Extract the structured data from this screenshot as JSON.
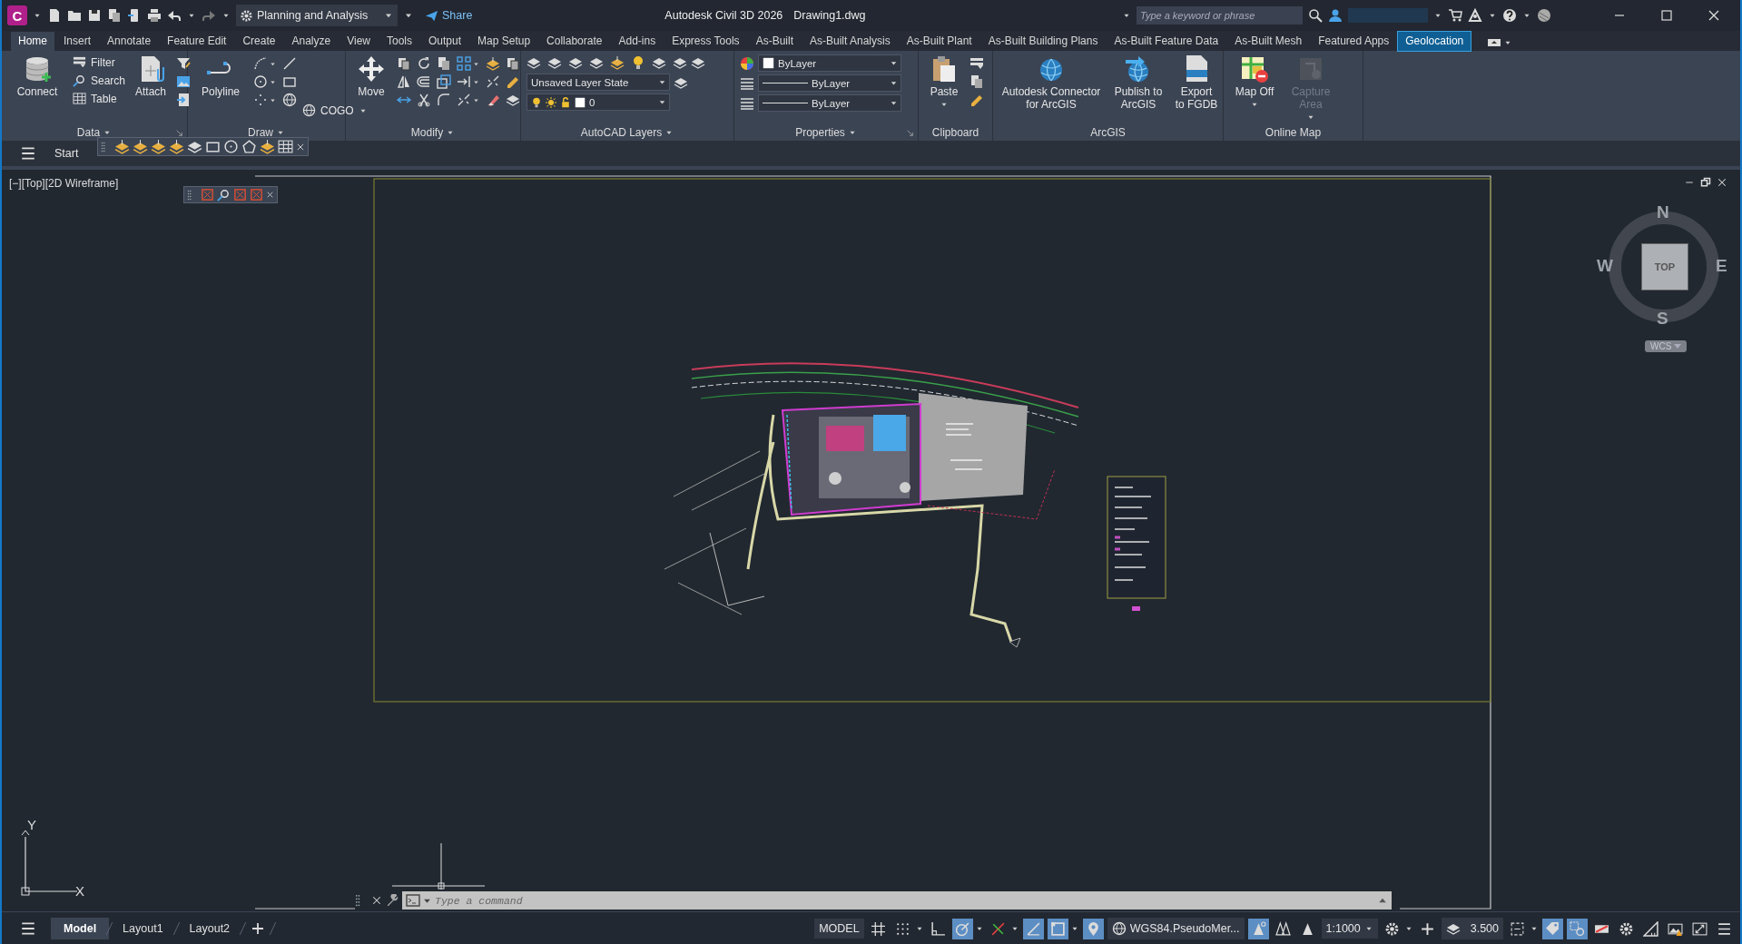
{
  "title_bar": {
    "app_letter": "C",
    "workspace": "Planning and Analysis",
    "share": "Share",
    "app_title": "Autodesk Civil 3D 2026",
    "file_name": "Drawing1.dwg",
    "search": {
      "placeholder": "Type a keyword or phrase"
    }
  },
  "ribbon_tabs": [
    {
      "label": "Home",
      "selected": true,
      "highlighted": false
    },
    {
      "label": "Insert",
      "selected": false,
      "highlighted": false
    },
    {
      "label": "Annotate",
      "selected": false,
      "highlighted": false
    },
    {
      "label": "Feature Edit",
      "selected": false,
      "highlighted": false
    },
    {
      "label": "Create",
      "selected": false,
      "highlighted": false
    },
    {
      "label": "Analyze",
      "selected": false,
      "highlighted": false
    },
    {
      "label": "View",
      "selected": false,
      "highlighted": false
    },
    {
      "label": "Tools",
      "selected": false,
      "highlighted": false
    },
    {
      "label": "Output",
      "selected": false,
      "highlighted": false
    },
    {
      "label": "Map Setup",
      "selected": false,
      "highlighted": false
    },
    {
      "label": "Collaborate",
      "selected": false,
      "highlighted": false
    },
    {
      "label": "Add-ins",
      "selected": false,
      "highlighted": false
    },
    {
      "label": "Express Tools",
      "selected": false,
      "highlighted": false
    },
    {
      "label": "As-Built",
      "selected": false,
      "highlighted": false
    },
    {
      "label": "As-Built Analysis",
      "selected": false,
      "highlighted": false
    },
    {
      "label": "As-Built Plant",
      "selected": false,
      "highlighted": false
    },
    {
      "label": "As-Built Building Plans",
      "selected": false,
      "highlighted": false
    },
    {
      "label": "As-Built Feature Data",
      "selected": false,
      "highlighted": false
    },
    {
      "label": "As-Built Mesh",
      "selected": false,
      "highlighted": false
    },
    {
      "label": "Featured Apps",
      "selected": false,
      "highlighted": false
    },
    {
      "label": "Geolocation",
      "selected": false,
      "highlighted": true
    }
  ],
  "ribbon_panels": [
    {
      "title": "Data",
      "columns": [
        {
          "kind": "large",
          "label": "Connect",
          "dropdown": false,
          "disabled": false
        },
        {
          "kind": "small",
          "items": [
            {
              "label": "Filter"
            },
            {
              "label": "Search"
            },
            {
              "label": "Table"
            }
          ]
        },
        {
          "kind": "large",
          "label": "Attach",
          "dropdown": false,
          "disabled": false
        },
        {
          "kind": "icons"
        }
      ]
    },
    {
      "title": "Draw",
      "columns": [
        {
          "kind": "large",
          "label": "Polyline",
          "dropdown": false,
          "disabled": false
        },
        {
          "kind": "icons"
        },
        {
          "kind": "icons"
        },
        {
          "kind": "small",
          "items": [
            {
              "label": "COGO"
            }
          ]
        }
      ]
    },
    {
      "title": "Modify",
      "columns": [
        {
          "kind": "large",
          "label": "Move",
          "dropdown": false,
          "disabled": false
        },
        {
          "kind": "icons"
        },
        {
          "kind": "icons"
        },
        {
          "kind": "icons"
        },
        {
          "kind": "icons"
        },
        {
          "kind": "icons"
        },
        {
          "kind": "icons"
        }
      ]
    },
    {
      "title": "AutoCAD Layers",
      "columns": [
        {
          "kind": "combos",
          "combos": [
            {
              "kind": "iconrow"
            },
            {
              "kind": "plain",
              "value": "Unsaved Layer State"
            },
            {
              "kind": "layer",
              "value": "0"
            }
          ]
        }
      ]
    },
    {
      "title": "Properties",
      "columns": [
        {
          "kind": "combos",
          "combos": [
            {
              "kind": "color",
              "value": "ByLayer"
            },
            {
              "kind": "line",
              "value": "ByLayer"
            },
            {
              "kind": "line",
              "value": "ByLayer"
            }
          ]
        }
      ]
    },
    {
      "title": "Clipboard",
      "columns": [
        {
          "kind": "large",
          "label": "Paste",
          "dropdown": true,
          "disabled": false
        },
        {
          "kind": "icons"
        }
      ]
    },
    {
      "title": "ArcGIS",
      "columns": [
        {
          "kind": "large",
          "label": "Autodesk Connector for ArcGIS",
          "dropdown": false,
          "disabled": false
        },
        {
          "kind": "large",
          "label": "Publish to ArcGIS",
          "dropdown": false,
          "disabled": false
        },
        {
          "kind": "large",
          "label": "Export to FGDB",
          "dropdown": false,
          "disabled": false
        }
      ]
    },
    {
      "title": "Online Map",
      "columns": [
        {
          "kind": "large",
          "label": "Map Off",
          "dropdown": true,
          "disabled": false
        },
        {
          "kind": "large",
          "label": "Capture Area",
          "dropdown": true,
          "disabled": true
        }
      ]
    }
  ],
  "file_tabs": [
    {
      "label": "Start",
      "selected": false
    }
  ],
  "viewport": {
    "label": "[−][Top][2D Wireframe]",
    "viewcube": {
      "north": "N",
      "south": "S",
      "east": "E",
      "west": "W",
      "face": "TOP",
      "ucs": "WCS"
    },
    "ucs_icon": {
      "x": "X",
      "y": "Y"
    },
    "command_line": {
      "placeholder": "Type a command"
    }
  },
  "layout_tabs": [
    {
      "label": "Model",
      "selected": true
    },
    {
      "label": "Layout1",
      "selected": false
    },
    {
      "label": "Layout2",
      "selected": false
    }
  ],
  "status_items": [
    {
      "kind": "text",
      "label": "MODEL",
      "dropdown": false
    },
    {
      "kind": "toggle",
      "on": false,
      "dropdown": false
    },
    {
      "kind": "toggle",
      "on": false,
      "dropdown": true
    },
    {
      "kind": "toggle",
      "on": false,
      "dropdown": false
    },
    {
      "kind": "toggle",
      "on": true,
      "dropdown": true
    },
    {
      "kind": "toggle",
      "on": false,
      "dropdown": true
    },
    {
      "kind": "toggle",
      "on": true,
      "dropdown": false
    },
    {
      "kind": "toggle",
      "on": true,
      "dropdown": true
    },
    {
      "kind": "toggle",
      "on": true,
      "dropdown": false
    },
    {
      "kind": "coord",
      "label": "WGS84.PseudoMer...",
      "dropdown": false
    },
    {
      "kind": "toggle",
      "on": true,
      "dropdown": false
    },
    {
      "kind": "toggle",
      "on": false,
      "dropdown": false
    },
    {
      "kind": "toggle",
      "on": false,
      "dropdown": false
    },
    {
      "kind": "text",
      "label": "1:1000",
      "dropdown": true
    },
    {
      "kind": "toggle",
      "on": false,
      "dropdown": true
    },
    {
      "kind": "toggle",
      "on": false,
      "dropdown": false
    },
    {
      "kind": "layer",
      "label": "3.500",
      "dropdown": false
    },
    {
      "kind": "toggle",
      "on": false,
      "dropdown": true
    },
    {
      "kind": "toggle",
      "on": true,
      "dropdown": false
    },
    {
      "kind": "toggle",
      "on": true,
      "dropdown": false
    },
    {
      "kind": "toggle",
      "on": false,
      "dropdown": false
    },
    {
      "kind": "toggle",
      "on": false,
      "dropdown": false
    },
    {
      "kind": "toggle",
      "on": false,
      "dropdown": false
    },
    {
      "kind": "toggle",
      "on": false,
      "dropdown": false
    },
    {
      "kind": "toggle",
      "on": false,
      "dropdown": false
    },
    {
      "kind": "toggle",
      "on": false,
      "dropdown": false
    }
  ]
}
